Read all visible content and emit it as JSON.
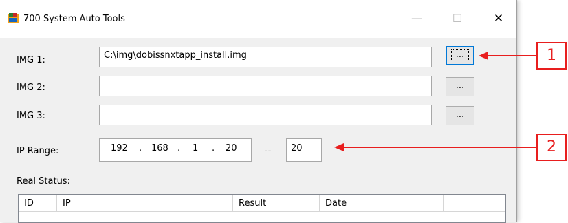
{
  "window": {
    "title": "700 System Auto Tools",
    "controls": {
      "minimize": "—",
      "maximize": "☐",
      "close": "✕"
    }
  },
  "form": {
    "img1": {
      "label": "IMG 1:",
      "value": "C:\\img\\dobissnxtapp_install.img",
      "browse": "..."
    },
    "img2": {
      "label": "IMG 2:",
      "value": "",
      "browse": "..."
    },
    "img3": {
      "label": "IMG 3:",
      "value": "",
      "browse": "..."
    },
    "ip_range": {
      "label": "IP Range:",
      "octets": [
        "192",
        "168",
        "1",
        "20"
      ],
      "separator": ".",
      "dash": "--",
      "end": "20"
    },
    "real_status_label": "Real Status:"
  },
  "table": {
    "columns": [
      "ID",
      "IP",
      "Result",
      "Date",
      ""
    ]
  },
  "callouts": [
    "1",
    "2"
  ],
  "colors": {
    "accent": "#e81e1e",
    "focus": "#0078d7"
  }
}
